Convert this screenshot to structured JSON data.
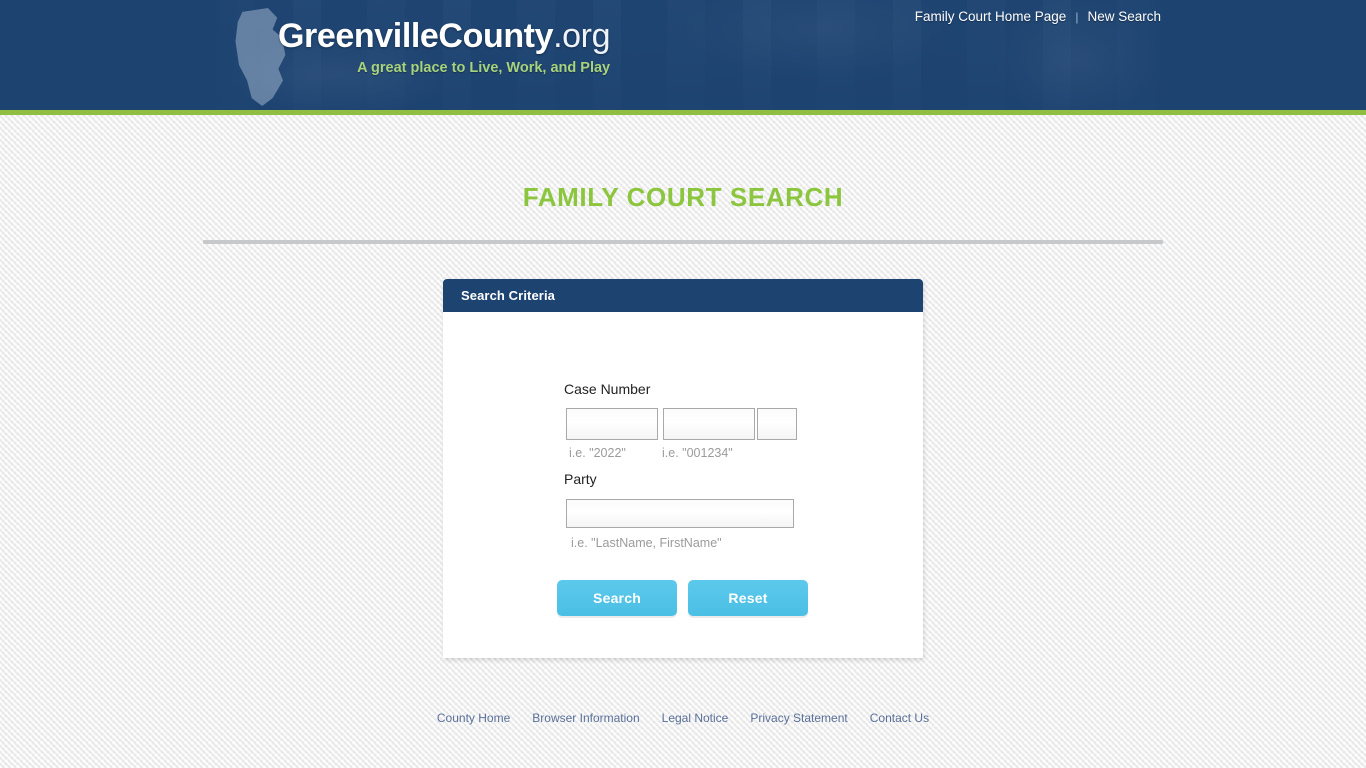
{
  "header": {
    "brand_name": "GreenvilleCounty",
    "brand_tld": ".org",
    "tagline": "A great place to Live, Work, and Play",
    "nav": {
      "home_label": "Family Court Home Page",
      "separator": "|",
      "new_search_label": "New Search"
    },
    "colors": {
      "background": "#1d4371",
      "accent_green": "#8fbe43",
      "tagline_green": "#a7d37c"
    }
  },
  "page": {
    "title": "FAMILY COURT SEARCH",
    "title_color": "#8cc63f"
  },
  "search_card": {
    "header_title": "Search Criteria",
    "case_number": {
      "label": "Case Number",
      "year": {
        "value": "",
        "placeholder": ""
      },
      "sequence": {
        "value": "",
        "placeholder": ""
      },
      "suffix": {
        "value": "",
        "placeholder": ""
      },
      "hint_year": "i.e. \"2022\"",
      "hint_sequence": "i.e. \"001234\""
    },
    "party": {
      "label": "Party",
      "value": "",
      "placeholder": "",
      "hint": "i.e. \"LastName, FirstName\""
    },
    "buttons": {
      "search_label": "Search",
      "reset_label": "Reset",
      "color": "#4bbfe4"
    }
  },
  "footer": {
    "links": [
      {
        "label": "County Home"
      },
      {
        "label": "Browser Information"
      },
      {
        "label": "Legal Notice"
      },
      {
        "label": "Privacy Statement"
      },
      {
        "label": "Contact Us"
      }
    ],
    "link_color": "#5a7099"
  }
}
